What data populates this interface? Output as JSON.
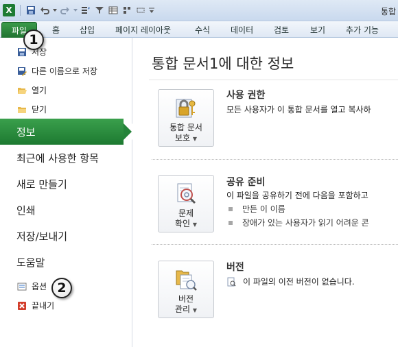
{
  "titlebar": {
    "app_logo": "X",
    "title": "통합"
  },
  "ribbon": {
    "file_tab": "파일",
    "tabs": [
      "홈",
      "삽입",
      "페이지 레이아웃",
      "수식",
      "데이터",
      "검토",
      "보기",
      "추가 기능"
    ]
  },
  "backstage": {
    "commands_top": [
      {
        "label": "저장",
        "icon": "save-icon"
      },
      {
        "label": "다른 이름으로 저장",
        "icon": "save-as-icon"
      },
      {
        "label": "열기",
        "icon": "open-folder-icon"
      },
      {
        "label": "닫기",
        "icon": "close-folder-icon"
      }
    ],
    "nav": [
      "정보",
      "최근에 사용한 항목",
      "새로 만들기",
      "인쇄",
      "저장/보내기",
      "도움말"
    ],
    "commands_bottom": [
      {
        "label": "옵션",
        "icon": "options-icon"
      },
      {
        "label": "끝내기",
        "icon": "exit-icon"
      }
    ],
    "active": "정보"
  },
  "callouts": [
    "1",
    "2"
  ],
  "info": {
    "title": "통합 문서1에 대한 정보",
    "sections": [
      {
        "button": {
          "line1": "통합 문서",
          "line2": "보호"
        },
        "heading": "사용 권한",
        "text": "모든 사용자가 이 통합 문서를 열고 복사하"
      },
      {
        "button": {
          "line1": "문제",
          "line2": "확인"
        },
        "heading": "공유 준비",
        "text": "이 파일을 공유하기 전에 다음을 포함하고",
        "bullets": [
          "만든 이 이름",
          "장애가 있는 사용자가 읽기 어려운 콘"
        ]
      },
      {
        "button": {
          "line1": "버전",
          "line2": "관리"
        },
        "heading": "버전",
        "text": "이 파일의 이전 버전이 없습니다."
      }
    ]
  },
  "colors": {
    "accent": "#1f7a31",
    "file_tab": "#2a8a3c"
  }
}
